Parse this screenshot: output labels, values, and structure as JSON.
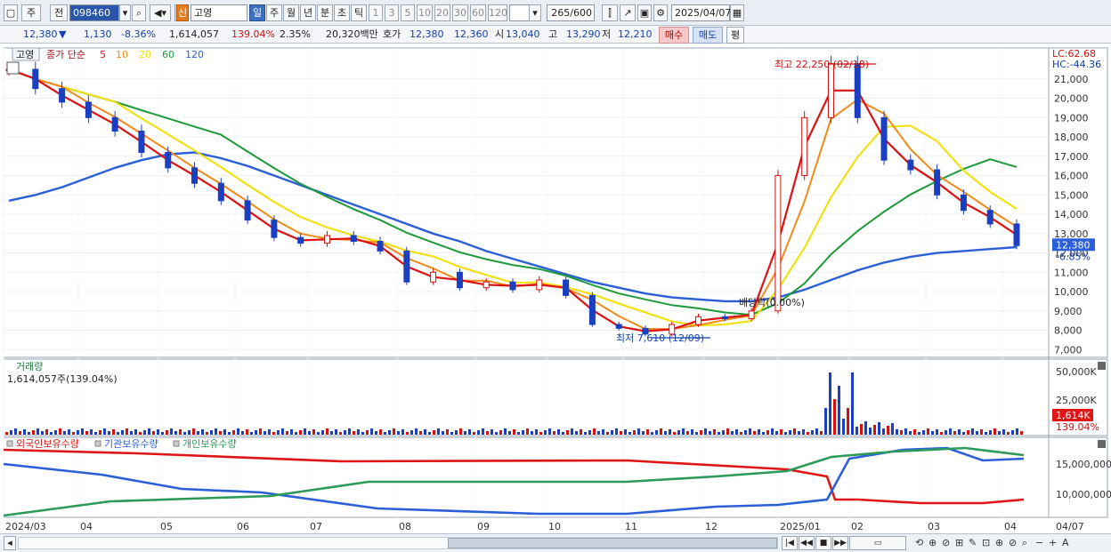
{
  "toolbar": {
    "market": "주",
    "prefix": "전",
    "code": "098460",
    "badge": "신",
    "name": "고영",
    "periods": [
      "일",
      "주",
      "월",
      "년",
      "분",
      "초",
      "틱"
    ],
    "active_period": "일",
    "minutes": [
      "1",
      "3",
      "5",
      "10",
      "20",
      "30",
      "60",
      "120"
    ],
    "count": "265",
    "count_total": "/600",
    "date": "2025/04/07"
  },
  "quote": {
    "price": "12,380",
    "arrow": "▼",
    "change": "1,130",
    "pct": "-8.36%",
    "volume": "1,614,057",
    "vol_ratio": "139.04%",
    "turnover": "2.35%",
    "amount": "20,320백만",
    "bid_label": "호가",
    "ask": "12,380",
    "bid": "12,360",
    "open_label": "시",
    "open": "13,040",
    "high_label": "고",
    "high": "13,290",
    "low_label": "저",
    "low": "12,210",
    "buy_label": "매수",
    "sell_label": "매도",
    "eval_label": "평"
  },
  "legend": {
    "name": "고영",
    "ma_label": "종가 단순",
    "periods": [
      "5",
      "10",
      "20",
      "60",
      "120"
    ],
    "colors": [
      "#dd1111",
      "#f08a18",
      "#f0e000",
      "#1f9a3a",
      "#2a5fd8"
    ]
  },
  "right_info": {
    "lc": "LC:62.68",
    "hc": "HC:-44.36"
  },
  "annotations": {
    "high": "최고 22,250 (02/18)",
    "low": "최저 7,610 (12/09)",
    "dividend": "배당락(0.00%)"
  },
  "volume_panel": {
    "title": "거래량",
    "value": "1,614,057주(139.04%)",
    "ticks": [
      "50,000K",
      "25,000K"
    ],
    "last": "1,614K",
    "last_pct": "139.04%"
  },
  "holdings_panel": {
    "series": [
      "외국인보유수량",
      "기관보유수량",
      "개인보유수량"
    ],
    "colors": [
      "#e01616",
      "#2a5fd8",
      "#2c9a5a"
    ],
    "ticks": [
      "15,000,000",
      "10,000,000"
    ]
  },
  "price_axis": {
    "ticks": [
      "21,000",
      "20,000",
      "19,000",
      "18,000",
      "17,000",
      "16,000",
      "15,000",
      "14,000",
      "13,000",
      "12,000",
      "11,000",
      "10,000",
      "9,000",
      "8,000",
      "7,000"
    ],
    "current": "12,380",
    "current_pct": "-6.85%"
  },
  "x_axis": {
    "labels": [
      "2024/03",
      "04",
      "05",
      "06",
      "07",
      "08",
      "09",
      "10",
      "11",
      "12",
      "2025/01",
      "02",
      "03",
      "04"
    ],
    "end": "04/07"
  },
  "chart_data": {
    "type": "line",
    "x_ticks": [
      "2024/03",
      "04",
      "05",
      "06",
      "07",
      "08",
      "09",
      "10",
      "11",
      "12",
      "2025/01",
      "02",
      "03",
      "04"
    ],
    "ylim": [
      7000,
      22250
    ],
    "high": {
      "value": 22250,
      "date": "02/18"
    },
    "low": {
      "value": 7610,
      "date": "12/09"
    },
    "last_close": 12380,
    "series": [
      {
        "name": "종가",
        "values": [
          21500,
          20500,
          19800,
          19000,
          18300,
          17200,
          16400,
          15600,
          14700,
          13700,
          12800,
          12500,
          12900,
          12600,
          12100,
          10500,
          11000,
          10200,
          10500,
          10100,
          10600,
          9800,
          8300,
          8100,
          7800,
          8300,
          8700,
          8600,
          9000,
          16000,
          19000,
          21800,
          19000,
          16800,
          16300,
          15000,
          14200,
          13500,
          12380
        ]
      },
      {
        "name": "120",
        "values": [
          14700,
          15000,
          15400,
          15900,
          16400,
          16800,
          17100,
          17200,
          16900,
          16500,
          16000,
          15500,
          15000,
          14500,
          14000,
          13500,
          13000,
          12600,
          12100,
          11700,
          11300,
          10900,
          10500,
          10200,
          9900,
          9700,
          9600,
          9500,
          9500,
          9700,
          10100,
          10600,
          11100,
          11500,
          11800,
          12000,
          12100,
          12200,
          12300
        ]
      }
    ]
  }
}
